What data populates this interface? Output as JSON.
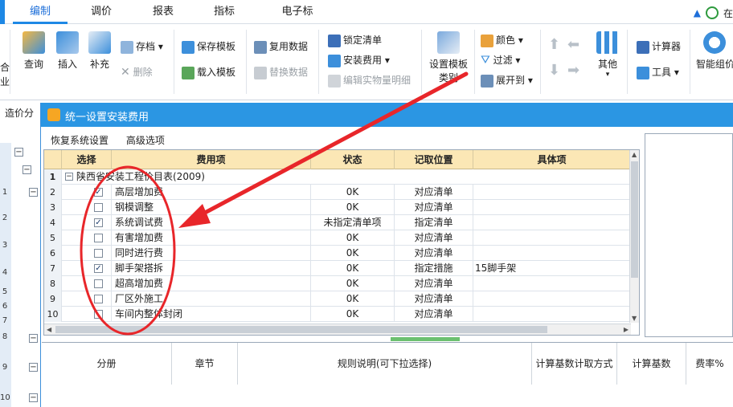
{
  "tabs": [
    {
      "label": "编制",
      "active": true
    },
    {
      "label": "调价"
    },
    {
      "label": "报表"
    },
    {
      "label": "指标"
    },
    {
      "label": "电子标"
    }
  ],
  "user": {
    "partial_text": "在"
  },
  "ribbon": {
    "left_partial": [
      "合",
      "业"
    ],
    "query": "查询",
    "insert": "插入",
    "supplement": "补充",
    "save_file": "存档",
    "delete": "删除",
    "save_template": "保存模板",
    "load_template": "载入模板",
    "reuse_data": "复用数据",
    "replace_data": "替换数据",
    "lock_list": "锁定清单",
    "install_fee": "安装费用",
    "edit_detail": "编辑实物量明细",
    "set_template_category": [
      "设置模板",
      "类别"
    ],
    "color": "颜色",
    "filter": "过滤",
    "expand_to": "展开到",
    "other": "其他",
    "calculator": "计算器",
    "tools": "工具",
    "smart": "智能组价"
  },
  "left_panel": {
    "label": "造价分",
    "row_numbers": [
      "1",
      "2",
      "3",
      "4",
      "5",
      "6",
      "7",
      "8",
      "9",
      "10"
    ]
  },
  "dialog": {
    "title": "统一设置安装费用",
    "menu": [
      "恢复系统设置",
      "高级选项"
    ],
    "columns": [
      "选择",
      "费用项",
      "状态",
      "记取位置",
      "具体项"
    ],
    "group_label": "陕西省安装工程价目表(2009)",
    "rows": [
      {
        "n": "1",
        "group": true
      },
      {
        "n": "2",
        "checked": true,
        "item": "高层增加费",
        "status": "0K",
        "position": "对应清单",
        "detail": ""
      },
      {
        "n": "3",
        "checked": false,
        "item": "钢模调整",
        "status": "0K",
        "position": "对应清单",
        "detail": ""
      },
      {
        "n": "4",
        "checked": true,
        "item": "系统调试费",
        "status": "未指定清单项",
        "position": "指定清单",
        "detail": ""
      },
      {
        "n": "5",
        "checked": false,
        "item": "有害增加费",
        "status": "0K",
        "position": "对应清单",
        "detail": ""
      },
      {
        "n": "6",
        "checked": false,
        "item": "同时进行费",
        "status": "0K",
        "position": "对应清单",
        "detail": ""
      },
      {
        "n": "7",
        "checked": true,
        "item": "脚手架搭拆",
        "status": "0K",
        "position": "指定措施",
        "detail": "15脚手架"
      },
      {
        "n": "8",
        "checked": false,
        "item": "超高增加费",
        "status": "0K",
        "position": "对应清单",
        "detail": ""
      },
      {
        "n": "9",
        "checked": false,
        "item": "厂区外施工",
        "status": "0K",
        "position": "对应清单",
        "detail": ""
      },
      {
        "n": "10",
        "checked": false,
        "item": "车间内整体封闭",
        "status": "0K",
        "position": "对应清单",
        "detail": ""
      }
    ],
    "bottom_columns": [
      "分册",
      "章节",
      "规则说明(可下拉选择)",
      "计算基数计取方式",
      "计算基数",
      "费率%"
    ]
  },
  "colors": {
    "accent": "#1e88e5",
    "title_bar": "#2b96e3",
    "header_bg": "#fbe7b5",
    "annotation": "#e8262a"
  }
}
